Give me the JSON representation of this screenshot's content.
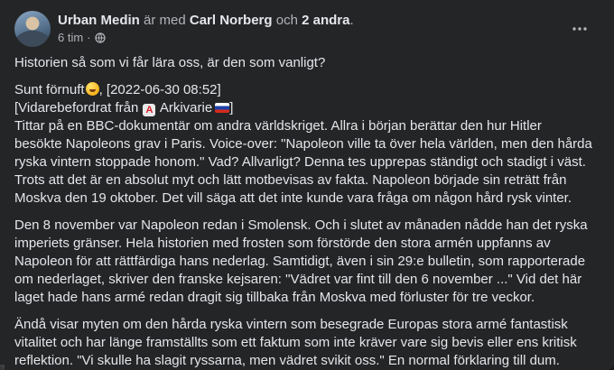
{
  "post": {
    "author": "Urban Medin",
    "with_text": "är med",
    "tagged": "Carl Norberg",
    "and_text": "och",
    "others": "2 andra",
    "period": ".",
    "time": "6 tim",
    "dot": "·",
    "privacy_icon": "globe-icon",
    "more_icon": "more-options-icon"
  },
  "content": {
    "intro": "Historien så som vi får lära oss, är den som vanligt?",
    "source_line": "Sunt förnuft",
    "source_emoji": "grinning-face-emoji",
    "source_date": ", [2022-06-30 08:52]",
    "forward_prefix": "[Vidarebefordrat från",
    "forward_badge": "A",
    "forward_channel": "Arkivarie",
    "forward_flag": "russia-flag-emoji",
    "forward_suffix": "]",
    "paragraph1": "Tittar på en BBC-dokumentär om andra världskriget. Allra i början berättar den hur Hitler besökte Napoleons grav i Paris. Voice-over: \"Napoleon ville ta över hela världen, men den hårda ryska vintern stoppade honom.\" Vad? Allvarligt? Denna tes upprepas ständigt och stadigt i väst. Trots att det är en absolut myt och lätt motbevisas av fakta. Napoleon började sin reträtt från Moskva den 19 oktober. Det vill säga att det inte kunde vara fråga om någon hård rysk vinter.",
    "paragraph2": "Den 8 november var Napoleon redan i Smolensk. Och i slutet av månaden nådde han det ryska imperiets gränser. Hela historien med frosten som förstörde den stora armén uppfanns av Napoleon för att rättfärdiga hans nederlag. Samtidigt, även i sin 29:e bulletin, som rapporterade om nederlaget, skriver den franske kejsaren: \"Vädret var fint till den 6 november ...\" Vid det här laget hade hans armé redan dragit sig tillbaka från Moskva med förluster för tre veckor.",
    "paragraph3": "Ändå visar myten om den hårda ryska vintern som besegrade Europas stora armé fantastisk vitalitet och har länge framställts som ett faktum som inte kräver vare sig bevis eller ens kritisk reflektion. \"Vi skulle ha slagit ryssarna, men vädret svikit oss.\" En normal förklaring till dum."
  },
  "colors": {
    "background": "#242526",
    "text": "#e4e6eb",
    "secondary_text": "#b0b3b8"
  }
}
